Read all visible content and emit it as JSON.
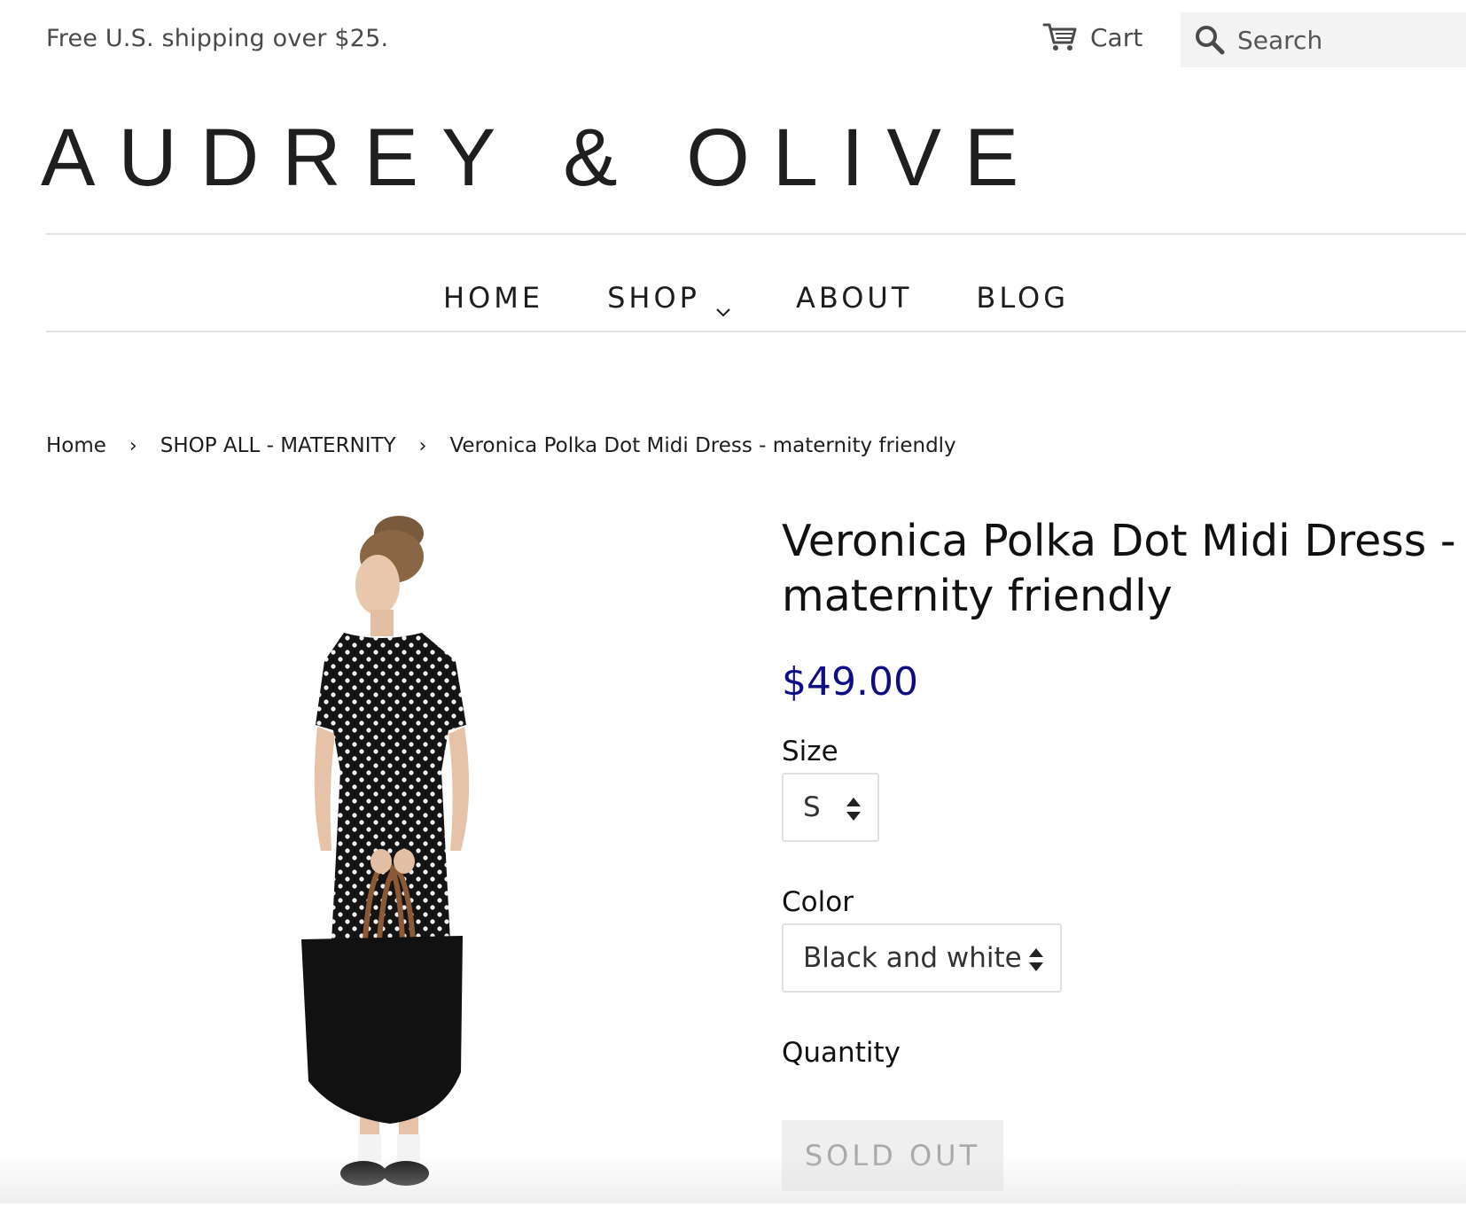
{
  "topbar": {
    "shipping_text": "Free U.S. shipping over $25.",
    "cart_label": "Cart",
    "cart_icon": "cart-icon",
    "search_placeholder": "Search",
    "search_icon": "search-icon"
  },
  "logo": {
    "text": "AUDREY & OLIVE"
  },
  "nav": {
    "items": [
      {
        "label": "HOME"
      },
      {
        "label": "SHOP",
        "dropdown": true
      },
      {
        "label": "ABOUT"
      },
      {
        "label": "BLOG"
      }
    ]
  },
  "breadcrumb": {
    "items": [
      {
        "label": "Home"
      },
      {
        "label": "SHOP ALL - MATERNITY"
      },
      {
        "label": "Veronica Polka Dot Midi Dress - maternity friendly"
      }
    ],
    "separator": "›"
  },
  "product": {
    "title": "Veronica Polka Dot Midi Dress - maternity friendly",
    "price": "$49.00",
    "size_label": "Size",
    "size_value": "S",
    "color_label": "Color",
    "color_value": "Black and white",
    "quantity_label": "Quantity",
    "button_label": "SOLD OUT"
  },
  "colors": {
    "price": "#0e0d86",
    "sold_out_bg": "#efefef",
    "sold_out_text": "#a8a8a8",
    "search_bg": "#f3f3f3"
  }
}
